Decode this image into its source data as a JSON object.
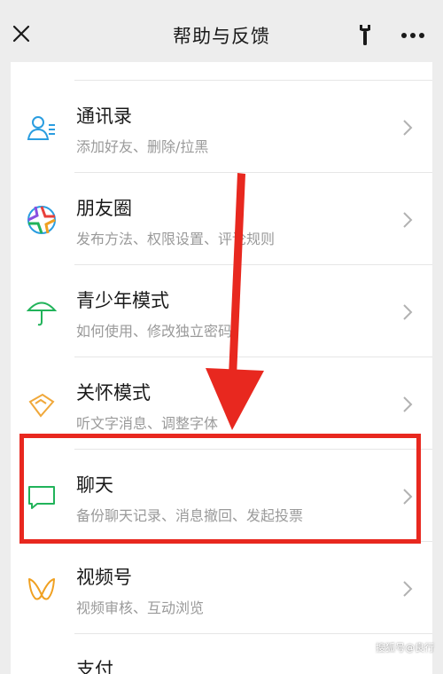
{
  "header": {
    "title": "帮助与反馈",
    "close_icon": "close-icon",
    "wrench_icon": "wrench-icon",
    "more_icon": "more-icon"
  },
  "items": [
    {
      "title": "通讯录",
      "subtitle": "添加好友、删除/拉黑",
      "icon": "contacts-icon",
      "color": "#2a9de0"
    },
    {
      "title": "朋友圈",
      "subtitle": "发布方法、权限设置、评论规则",
      "icon": "moments-icon",
      "color": "#e8a020"
    },
    {
      "title": "青少年模式",
      "subtitle": "如何使用、修改独立密码",
      "icon": "umbrella-icon",
      "color": "#21b35a"
    },
    {
      "title": "关怀模式",
      "subtitle": "听文字消息、调整字体",
      "icon": "care-icon",
      "color": "#f0a83a"
    },
    {
      "title": "聊天",
      "subtitle": "备份聊天记录、消息撤回、发起投票",
      "icon": "chat-icon",
      "color": "#21b35a"
    },
    {
      "title": "视频号",
      "subtitle": "视频审核、互动浏览",
      "icon": "channels-icon",
      "color": "#f0a020"
    },
    {
      "title": "支付",
      "subtitle": "",
      "icon": "pay-icon",
      "color": "#21b35a"
    }
  ],
  "annotation": {
    "color": "#e8281f"
  },
  "watermark": "搜狐号@良行"
}
